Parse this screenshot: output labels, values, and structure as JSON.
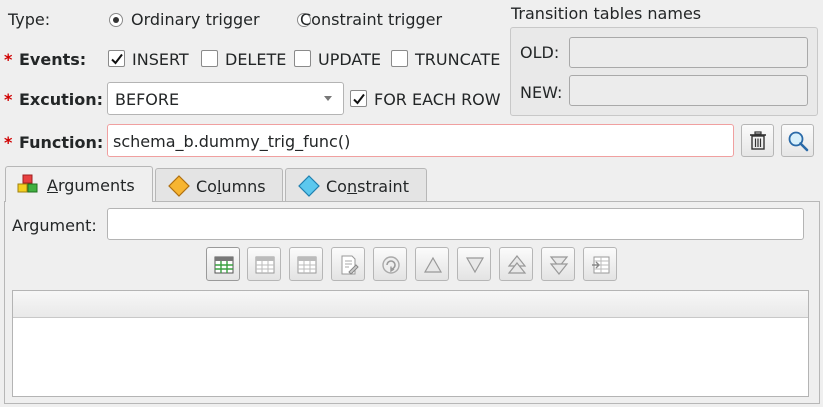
{
  "type_row": {
    "label": "Type:",
    "option_ordinary": "Ordinary trigger",
    "option_constraint": "Constraint trigger",
    "selected": "Ordinary trigger"
  },
  "events": {
    "required_mark": "*",
    "label": "Events:",
    "insert": "INSERT",
    "delete": "DELETE",
    "update": "UPDATE",
    "truncate": "TRUNCATE",
    "checked": [
      "INSERT"
    ]
  },
  "execution": {
    "required_mark": "*",
    "label": "Excution:",
    "value": "BEFORE",
    "for_each_row": "FOR EACH ROW",
    "for_each_row_checked": true
  },
  "function": {
    "required_mark": "*",
    "label": "Function:",
    "value": "schema_b.dummy_trig_func()",
    "delete_icon": "trash-icon",
    "search_icon": "magnifier-icon"
  },
  "transition": {
    "title": "Transition tables names",
    "old_label": "OLD:",
    "old_value": "",
    "new_label": "NEW:",
    "new_value": ""
  },
  "tabs": [
    {
      "label_prefix": "",
      "label_ul": "A",
      "label_rest": "rguments",
      "icon": "shapes-icon",
      "active": true
    },
    {
      "label_prefix": "Co",
      "label_ul": "l",
      "label_rest": "umns",
      "icon": "diamond-orange-icon",
      "active": false
    },
    {
      "label_prefix": "Co",
      "label_ul": "n",
      "label_rest": "straint",
      "icon": "diamond-blue-icon",
      "active": false
    }
  ],
  "arguments": {
    "label": "Argument:",
    "value": ""
  },
  "toolbar": [
    "add-item-icon",
    "update-item-icon",
    "remove-item-icon",
    "edit-item-icon",
    "clear-items-icon",
    "move-up-icon",
    "move-down-icon",
    "move-top-icon",
    "move-bottom-icon",
    "table-options-icon"
  ],
  "colors": {
    "required": "#d00000",
    "function_border": "#f0a0a0"
  }
}
